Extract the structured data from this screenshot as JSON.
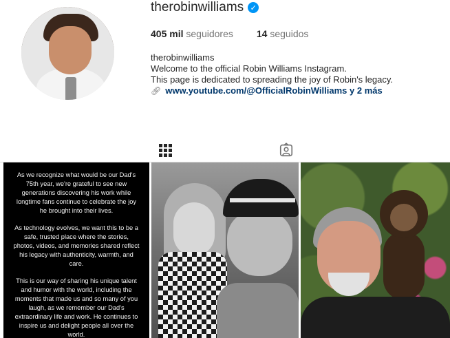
{
  "profile": {
    "username": "therobinwilliams",
    "verified": true,
    "followers_count": "405 mil",
    "followers_label": "seguidores",
    "following_count": "14",
    "following_label": "seguidos",
    "bio_name": "therobinwilliams",
    "bio_line1": "Welcome to the official Robin Williams Instagram.",
    "bio_line2": "This page is dedicated to spreading the joy of Robin's legacy.",
    "link_text": "www.youtube.com/@OfficialRobinWilliams y 2 más"
  },
  "tabs": [
    {
      "name": "posts",
      "icon": "grid-icon",
      "active": true
    },
    {
      "name": "tagged",
      "icon": "tagged-person-icon",
      "active": false
    }
  ],
  "posts": [
    {
      "type": "text",
      "paragraphs": [
        "As we recognize what would be our Dad's 75th year, we're grateful to see new generations discovering his work while longtime fans continue to celebrate the joy he brought into their lives.",
        "As technology evolves, we want this to be a safe, trusted place where the stories, photos, videos, and memories shared reflect his legacy with authenticity, warmth, and care.",
        "This is our way of sharing his unique talent and humor with the world, including the moments that made us and so many of you laugh, as we remember our Dad's extraordinary life and work. He continues to inspire us and delight people all over the world."
      ]
    },
    {
      "type": "photo",
      "subject": "black-and-white photo of man in cap holding child"
    },
    {
      "type": "photo",
      "subject": "smiling man with monkey on shoulder"
    }
  ],
  "colors": {
    "text": "#262626",
    "secondary": "#737373",
    "link": "#00376b",
    "verified": "#0095f6",
    "divider": "#dbdbdb"
  }
}
